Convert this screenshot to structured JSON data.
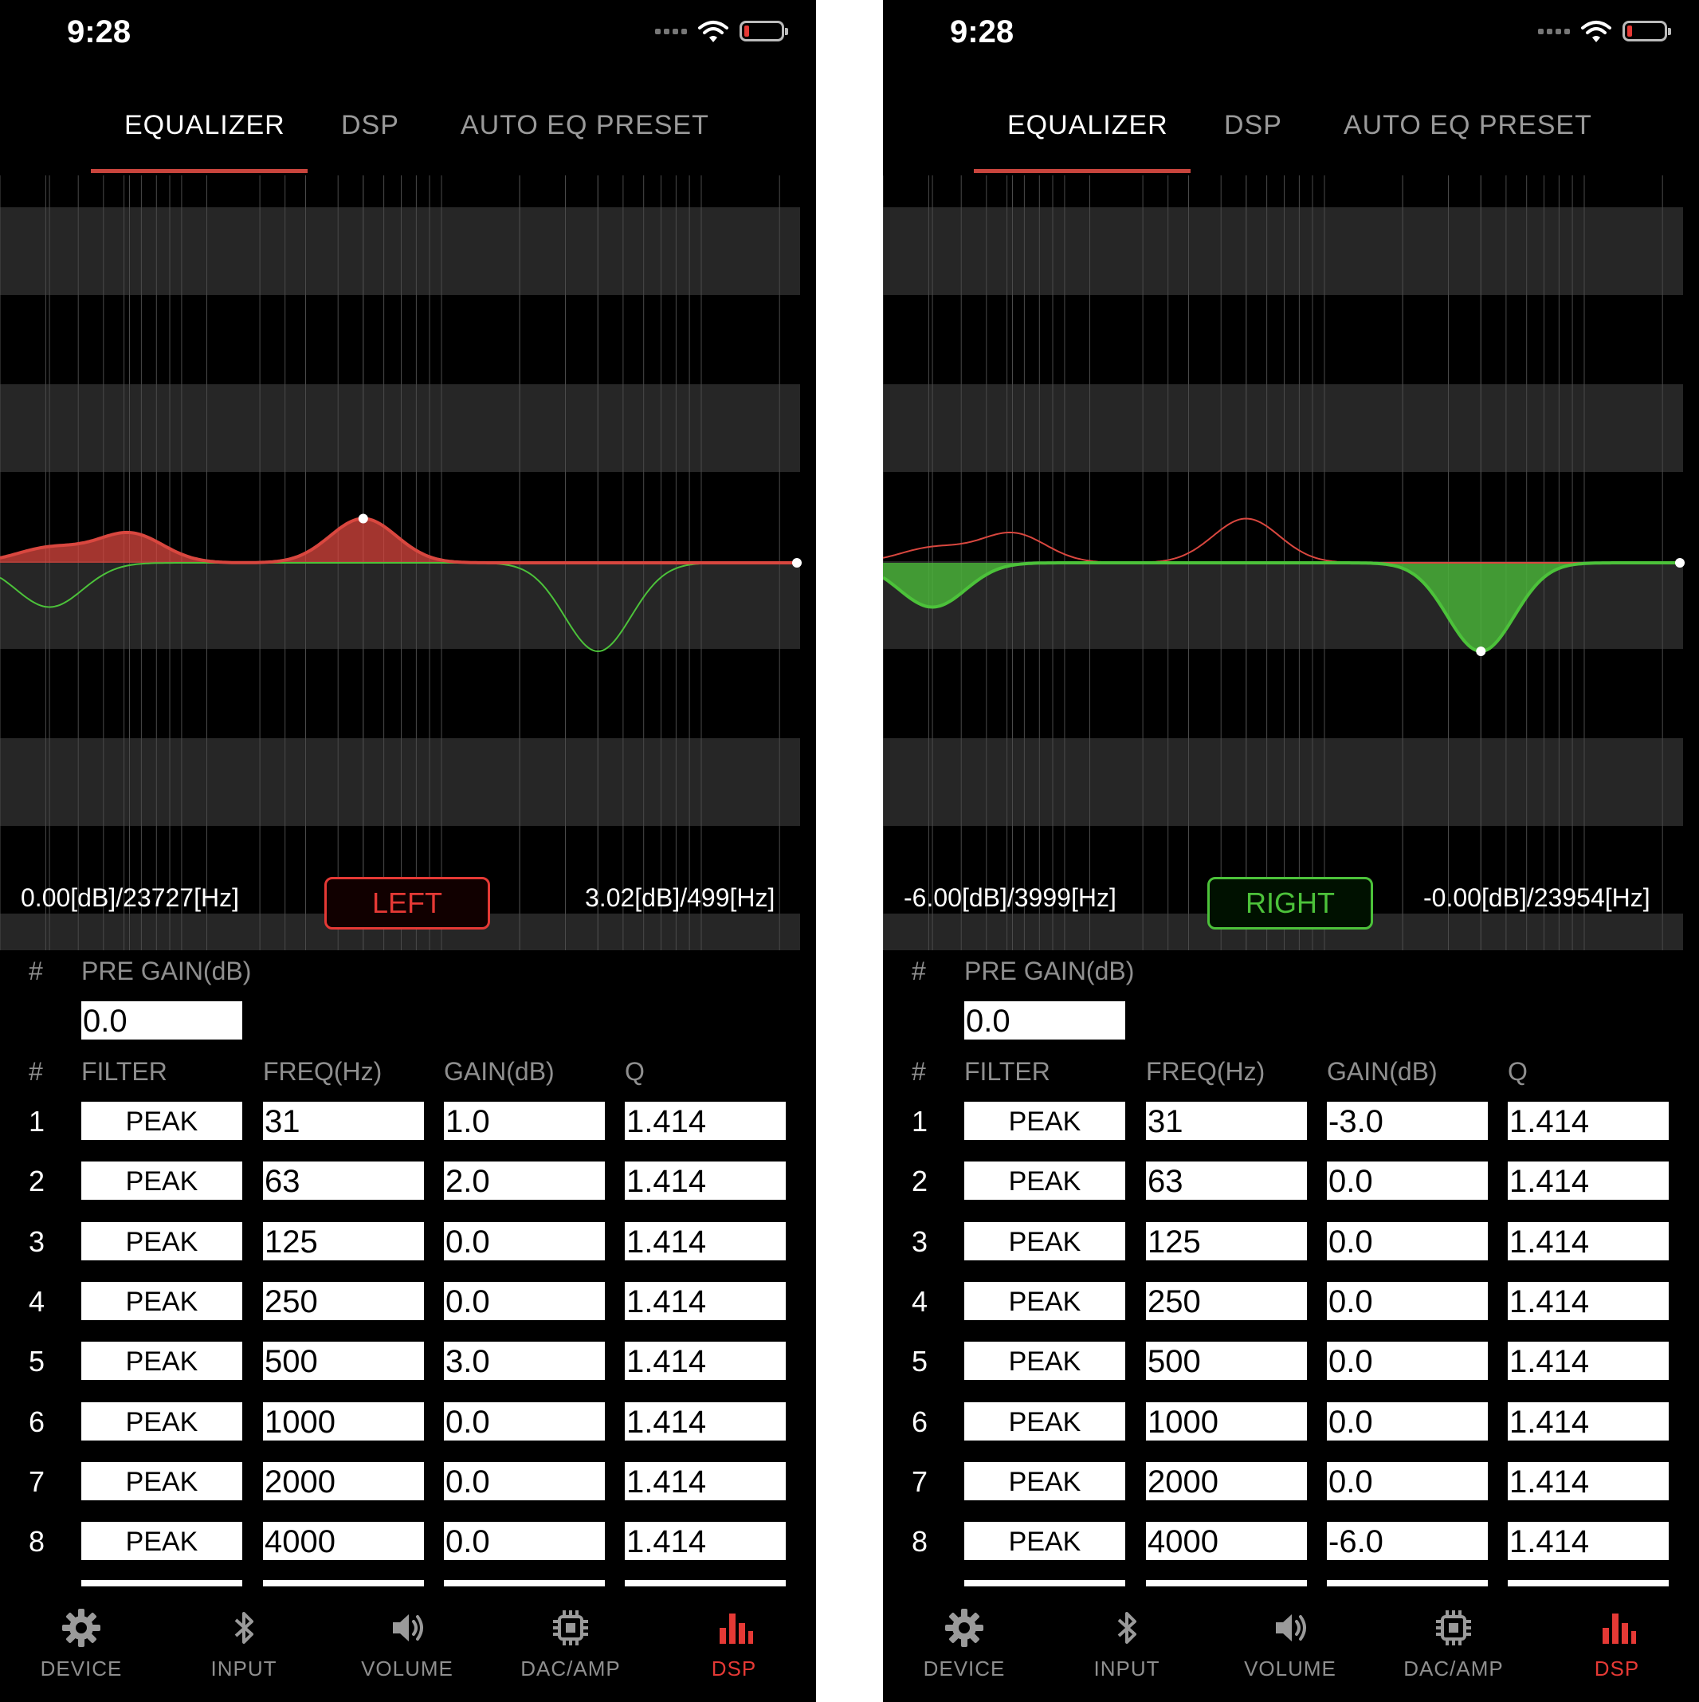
{
  "colors": {
    "accent": "#e53935",
    "left_curve": "#d9473f",
    "right_curve": "#4cc23a",
    "background": "#000000"
  },
  "status": {
    "time": "9:28"
  },
  "tabs": [
    {
      "label": "EQUALIZER",
      "active": true
    },
    {
      "label": "DSP"
    },
    {
      "label": "AUTO EQ PRESET"
    }
  ],
  "table": {
    "hash": "#",
    "pre_gain_label": "PRE GAIN(dB)",
    "headers": {
      "filter": "FILTER",
      "freq": "FREQ(Hz)",
      "gain": "GAIN(dB)",
      "q": "Q"
    }
  },
  "nav": [
    {
      "label": "DEVICE",
      "icon": "gear-icon"
    },
    {
      "label": "INPUT",
      "icon": "bluetooth-icon"
    },
    {
      "label": "VOLUME",
      "icon": "speaker-icon"
    },
    {
      "label": "DAC/AMP",
      "icon": "chip-icon"
    },
    {
      "label": "DSP",
      "icon": "bar-chart-icon",
      "active": true
    }
  ],
  "left": {
    "channel_label": "LEFT",
    "readout_left": "0.00[dB]/23727[Hz]",
    "readout_right": "3.02[dB]/499[Hz]",
    "pre_gain": "0.0",
    "rows": [
      {
        "num": "1",
        "filter": "PEAK",
        "freq": "31",
        "gain": "1.0",
        "q": "1.414"
      },
      {
        "num": "2",
        "filter": "PEAK",
        "freq": "63",
        "gain": "2.0",
        "q": "1.414"
      },
      {
        "num": "3",
        "filter": "PEAK",
        "freq": "125",
        "gain": "0.0",
        "q": "1.414"
      },
      {
        "num": "4",
        "filter": "PEAK",
        "freq": "250",
        "gain": "0.0",
        "q": "1.414"
      },
      {
        "num": "5",
        "filter": "PEAK",
        "freq": "500",
        "gain": "3.0",
        "q": "1.414"
      },
      {
        "num": "6",
        "filter": "PEAK",
        "freq": "1000",
        "gain": "0.0",
        "q": "1.414"
      },
      {
        "num": "7",
        "filter": "PEAK",
        "freq": "2000",
        "gain": "0.0",
        "q": "1.414"
      },
      {
        "num": "8",
        "filter": "PEAK",
        "freq": "4000",
        "gain": "0.0",
        "q": "1.414"
      }
    ]
  },
  "right": {
    "channel_label": "RIGHT",
    "readout_left": "-6.00[dB]/3999[Hz]",
    "readout_right": "-0.00[dB]/23954[Hz]",
    "pre_gain": "0.0",
    "rows": [
      {
        "num": "1",
        "filter": "PEAK",
        "freq": "31",
        "gain": "-3.0",
        "q": "1.414"
      },
      {
        "num": "2",
        "filter": "PEAK",
        "freq": "63",
        "gain": "0.0",
        "q": "1.414"
      },
      {
        "num": "3",
        "filter": "PEAK",
        "freq": "125",
        "gain": "0.0",
        "q": "1.414"
      },
      {
        "num": "4",
        "filter": "PEAK",
        "freq": "250",
        "gain": "0.0",
        "q": "1.414"
      },
      {
        "num": "5",
        "filter": "PEAK",
        "freq": "500",
        "gain": "0.0",
        "q": "1.414"
      },
      {
        "num": "6",
        "filter": "PEAK",
        "freq": "1000",
        "gain": "0.0",
        "q": "1.414"
      },
      {
        "num": "7",
        "filter": "PEAK",
        "freq": "2000",
        "gain": "0.0",
        "q": "1.414"
      },
      {
        "num": "8",
        "filter": "PEAK",
        "freq": "4000",
        "gain": "-6.0",
        "q": "1.414"
      }
    ]
  }
}
